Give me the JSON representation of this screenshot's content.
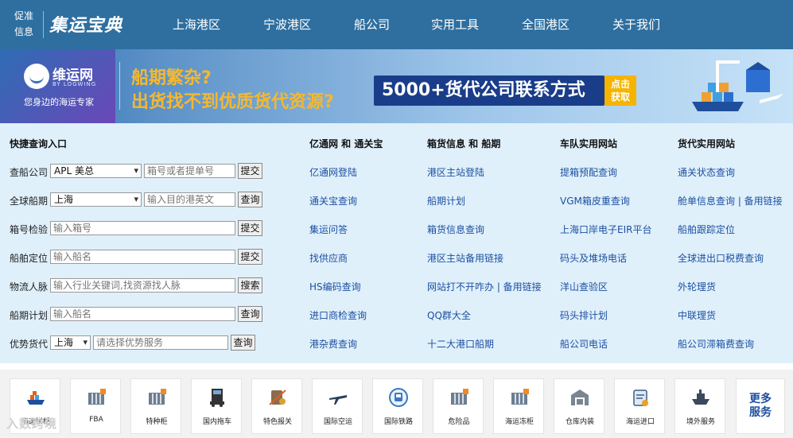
{
  "header": {
    "brand_small_1": "促准",
    "brand_small_2": "信息",
    "brand_logo": "集运宝典",
    "nav": [
      "上海港区",
      "宁波港区",
      "船公司",
      "实用工具",
      "全国港区",
      "关于我们"
    ]
  },
  "banner": {
    "logo_name": "维运网",
    "logo_en": "BY LOGWING",
    "slogan": "您身边的海运专家",
    "line1": "船期繁杂?",
    "line2": "出货找不到优质货代资源?",
    "pill": "5000+货代公司联系方式",
    "cta_1": "点击",
    "cta_2": "获取",
    "colors": {
      "headline": "#f5b82e",
      "pill_bg": "#1a3d8a",
      "cta_bg": "#f5b400"
    }
  },
  "quick_query": {
    "title": "快捷查询入口",
    "rows": [
      {
        "label": "查船公司",
        "select": "APL 美总",
        "input_placeholder": "箱号或者提单号",
        "button": "提交"
      },
      {
        "label": "全球船期",
        "select": "上海",
        "input_placeholder": "输入目的港英文",
        "button": "查询"
      },
      {
        "label": "箱号检验",
        "input_placeholder": "输入箱号",
        "button": "提交"
      },
      {
        "label": "船舶定位",
        "input_placeholder": "输入船名",
        "button": "提交"
      },
      {
        "label": "物流人脉",
        "input_placeholder": "输入行业关键词,找资源找人脉",
        "button": "搜索"
      },
      {
        "label": "船期计划",
        "input_placeholder": "输入船名",
        "button": "查询"
      },
      {
        "label": "优势货代",
        "select": "上海",
        "input_placeholder": "请选择优势服务",
        "button": "查询"
      }
    ]
  },
  "link_columns": [
    {
      "title": "亿通网 和 通关宝",
      "links": [
        "亿通网登陆",
        "通关宝查询",
        "集运问答",
        "找供应商",
        "HS编码查询",
        "进口商检查询",
        "港杂费查询"
      ]
    },
    {
      "title": "箱货信息 和 船期",
      "links": [
        "港区主站登陆",
        "船期计划",
        "箱货信息查询",
        "港区主站备用链接",
        "网站打不开咋办 | 备用链接",
        "QQ群大全",
        "十二大港口船期"
      ]
    },
    {
      "title": "车队实用网站",
      "links": [
        "提箱预配查询",
        "VGM箱皮重查询",
        "上海口岸电子EIR平台",
        "码头及堆场电话",
        "洋山查验区",
        "码头排计划",
        "船公司电话"
      ]
    },
    {
      "title": "货代实用网站",
      "links": [
        "通关状态查询",
        "舱单信息查询 | 备用链接",
        "船舶跟踪定位",
        "全球进出口税费查询",
        "外轮理货",
        "中联理货",
        "船公司滞箱费查询"
      ]
    }
  ],
  "services": {
    "items": [
      {
        "label": "海运拼柜",
        "icon": "cargo-ship-icon"
      },
      {
        "label": "FBA",
        "icon": "container-icon"
      },
      {
        "label": "特种柜",
        "icon": "container-icon"
      },
      {
        "label": "国内拖车",
        "icon": "truck-icon"
      },
      {
        "label": "特色报关",
        "icon": "customs-icon"
      },
      {
        "label": "国际空运",
        "icon": "airplane-icon"
      },
      {
        "label": "国际铁路",
        "icon": "train-icon"
      },
      {
        "label": "危险品",
        "icon": "container-icon"
      },
      {
        "label": "海运冻柜",
        "icon": "container-icon"
      },
      {
        "label": "仓库内装",
        "icon": "warehouse-icon"
      },
      {
        "label": "海运进口",
        "icon": "clipboard-icon"
      },
      {
        "label": "境外服务",
        "icon": "ship-icon"
      }
    ],
    "more_1": "更多",
    "more_2": "服务"
  },
  "watermark": "入数跨境"
}
